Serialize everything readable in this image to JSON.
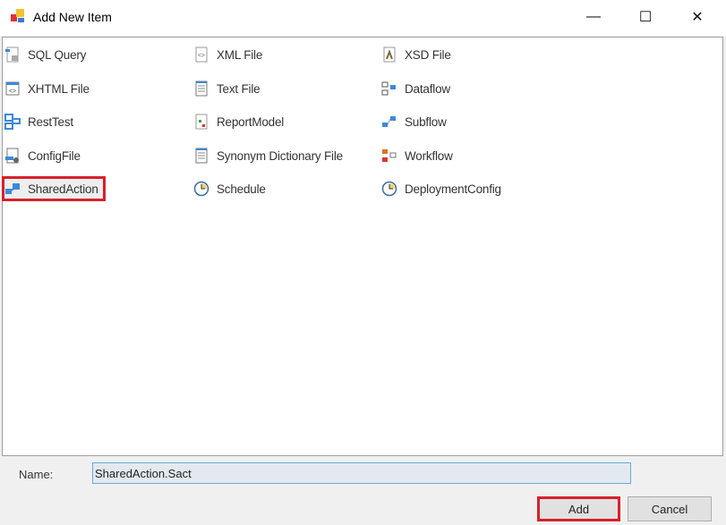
{
  "window": {
    "title": "Add New Item",
    "minimize": "—",
    "maximize": "☐",
    "close": "✕"
  },
  "items": [
    {
      "label": "SQL Query",
      "icon": "sql-query-icon"
    },
    {
      "label": "XML File",
      "icon": "xml-file-icon"
    },
    {
      "label": "XSD File",
      "icon": "xsd-file-icon"
    },
    {
      "label": "XHTML File",
      "icon": "xhtml-file-icon"
    },
    {
      "label": "Text File",
      "icon": "text-file-icon"
    },
    {
      "label": "Dataflow",
      "icon": "dataflow-icon"
    },
    {
      "label": "RestTest",
      "icon": "resttest-icon"
    },
    {
      "label": "ReportModel",
      "icon": "report-model-icon"
    },
    {
      "label": "Subflow",
      "icon": "subflow-icon"
    },
    {
      "label": "ConfigFile",
      "icon": "config-file-icon"
    },
    {
      "label": "Synonym Dictionary File",
      "icon": "text-file-icon"
    },
    {
      "label": "Workflow",
      "icon": "workflow-icon"
    },
    {
      "label": "SharedAction",
      "icon": "shared-action-icon"
    },
    {
      "label": "Schedule",
      "icon": "clock-icon"
    },
    {
      "label": "DeploymentConfig",
      "icon": "clock-icon"
    }
  ],
  "selected": "SharedAction",
  "form": {
    "name_label": "Name:",
    "name_value": "SharedAction.Sact"
  },
  "buttons": {
    "add": "Add",
    "cancel": "Cancel"
  },
  "colors": {
    "highlight": "#d8202a",
    "input_bg": "#e3e9f0"
  }
}
